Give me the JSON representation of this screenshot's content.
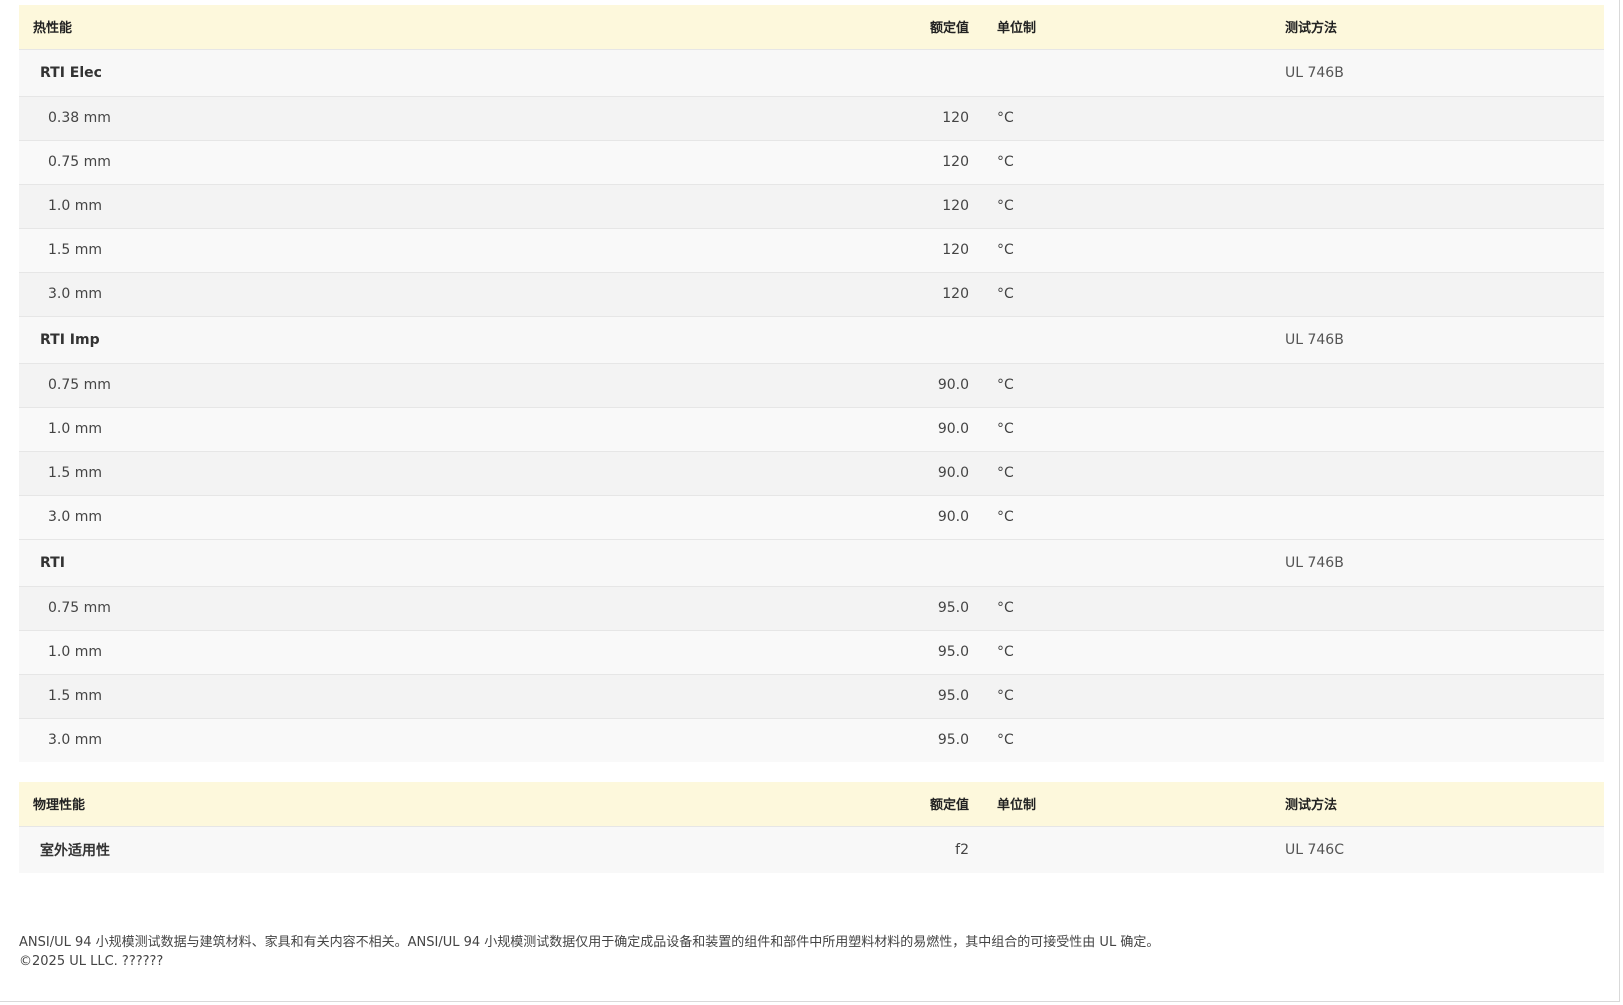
{
  "thermal": {
    "header": {
      "property": "热性能",
      "value": "额定值",
      "unit": "单位制",
      "method": "测试方法"
    },
    "groups": [
      {
        "name": "RTI Elec",
        "method": "UL 746B",
        "rows": [
          {
            "label": "0.38 mm",
            "value": "120",
            "unit": "°C"
          },
          {
            "label": "0.75 mm",
            "value": "120",
            "unit": "°C"
          },
          {
            "label": "1.0 mm",
            "value": "120",
            "unit": "°C"
          },
          {
            "label": "1.5 mm",
            "value": "120",
            "unit": "°C"
          },
          {
            "label": "3.0 mm",
            "value": "120",
            "unit": "°C"
          }
        ]
      },
      {
        "name": "RTI Imp",
        "method": "UL 746B",
        "rows": [
          {
            "label": "0.75 mm",
            "value": "90.0",
            "unit": "°C"
          },
          {
            "label": "1.0 mm",
            "value": "90.0",
            "unit": "°C"
          },
          {
            "label": "1.5 mm",
            "value": "90.0",
            "unit": "°C"
          },
          {
            "label": "3.0 mm",
            "value": "90.0",
            "unit": "°C"
          }
        ]
      },
      {
        "name": "RTI",
        "method": "UL 746B",
        "rows": [
          {
            "label": "0.75 mm",
            "value": "95.0",
            "unit": "°C"
          },
          {
            "label": "1.0 mm",
            "value": "95.0",
            "unit": "°C"
          },
          {
            "label": "1.5 mm",
            "value": "95.0",
            "unit": "°C"
          },
          {
            "label": "3.0 mm",
            "value": "95.0",
            "unit": "°C"
          }
        ]
      }
    ]
  },
  "physical": {
    "header": {
      "property": "物理性能",
      "value": "额定值",
      "unit": "单位制",
      "method": "测试方法"
    },
    "rows": [
      {
        "name": "室外适用性",
        "value": "f2",
        "unit": "",
        "method": "UL 746C"
      }
    ]
  },
  "footer": {
    "disclaimer": "ANSI/UL 94 小规模测试数据与建筑材料、家具和有关内容不相关。ANSI/UL 94 小规模测试数据仅用于确定成品设备和装置的组件和部件中所用塑料材料的易燃性，其中组合的可接受性由 UL 确定。",
    "copyright": "©2025 UL LLC. ??????"
  }
}
